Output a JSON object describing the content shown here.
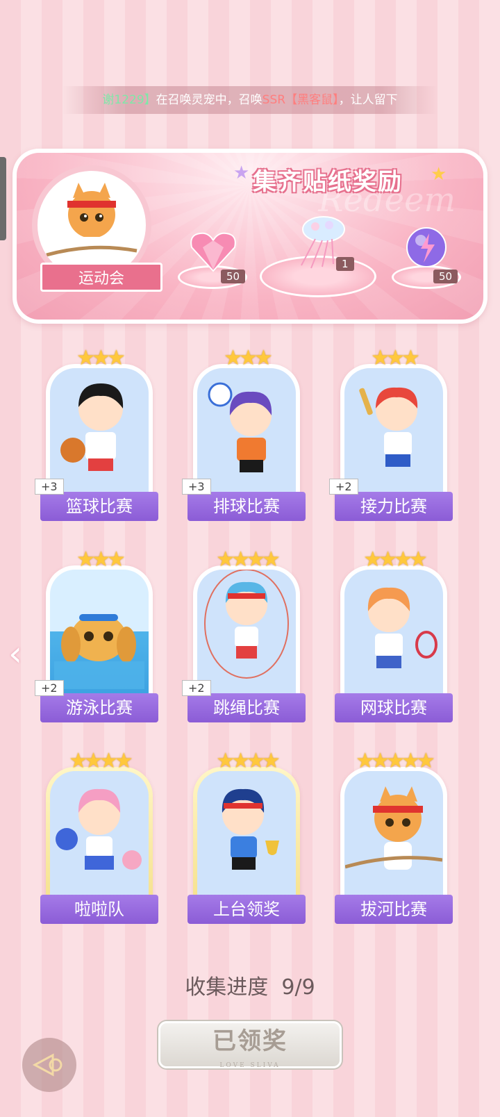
{
  "ticker": {
    "prefix": "谢1229】",
    "text1": "在召唤灵宠中，召唤",
    "rarity": "SSR【黑客鼠】",
    "text2": "，让人留下"
  },
  "panel": {
    "title": "集齐贴纸奖励",
    "watermark": "Redeem",
    "event_label": "运动会",
    "rewards": [
      {
        "icon": "pink-heart-gem-icon",
        "count": "50"
      },
      {
        "icon": "jellyfish-bouquet-icon",
        "count": "1"
      },
      {
        "icon": "lightning-orb-icon",
        "count": "50"
      }
    ]
  },
  "cards": [
    {
      "name": "篮球比赛",
      "stars": "★★★",
      "bonus": "+3"
    },
    {
      "name": "排球比赛",
      "stars": "★★★",
      "bonus": "+3"
    },
    {
      "name": "接力比赛",
      "stars": "★★★",
      "bonus": "+2"
    },
    {
      "name": "游泳比赛",
      "stars": "★★★",
      "bonus": "+2"
    },
    {
      "name": "跳绳比赛",
      "stars": "★★★★",
      "bonus": "+2"
    },
    {
      "name": "网球比赛",
      "stars": "★★★★",
      "bonus": ""
    },
    {
      "name": "啦啦队",
      "stars": "★★★★",
      "bonus": ""
    },
    {
      "name": "上台领奖",
      "stars": "★★★★",
      "bonus": ""
    },
    {
      "name": "拔河比赛",
      "stars": "★★★★★",
      "bonus": ""
    }
  ],
  "progress": {
    "label": "收集进度",
    "value": "9/9"
  },
  "claim_button": {
    "label": "已领奖",
    "sub": "LOVE SLIVA"
  },
  "colors": {
    "accent": "#8b5cd6",
    "pink": "#e9708d",
    "star": "#ffc83d"
  }
}
